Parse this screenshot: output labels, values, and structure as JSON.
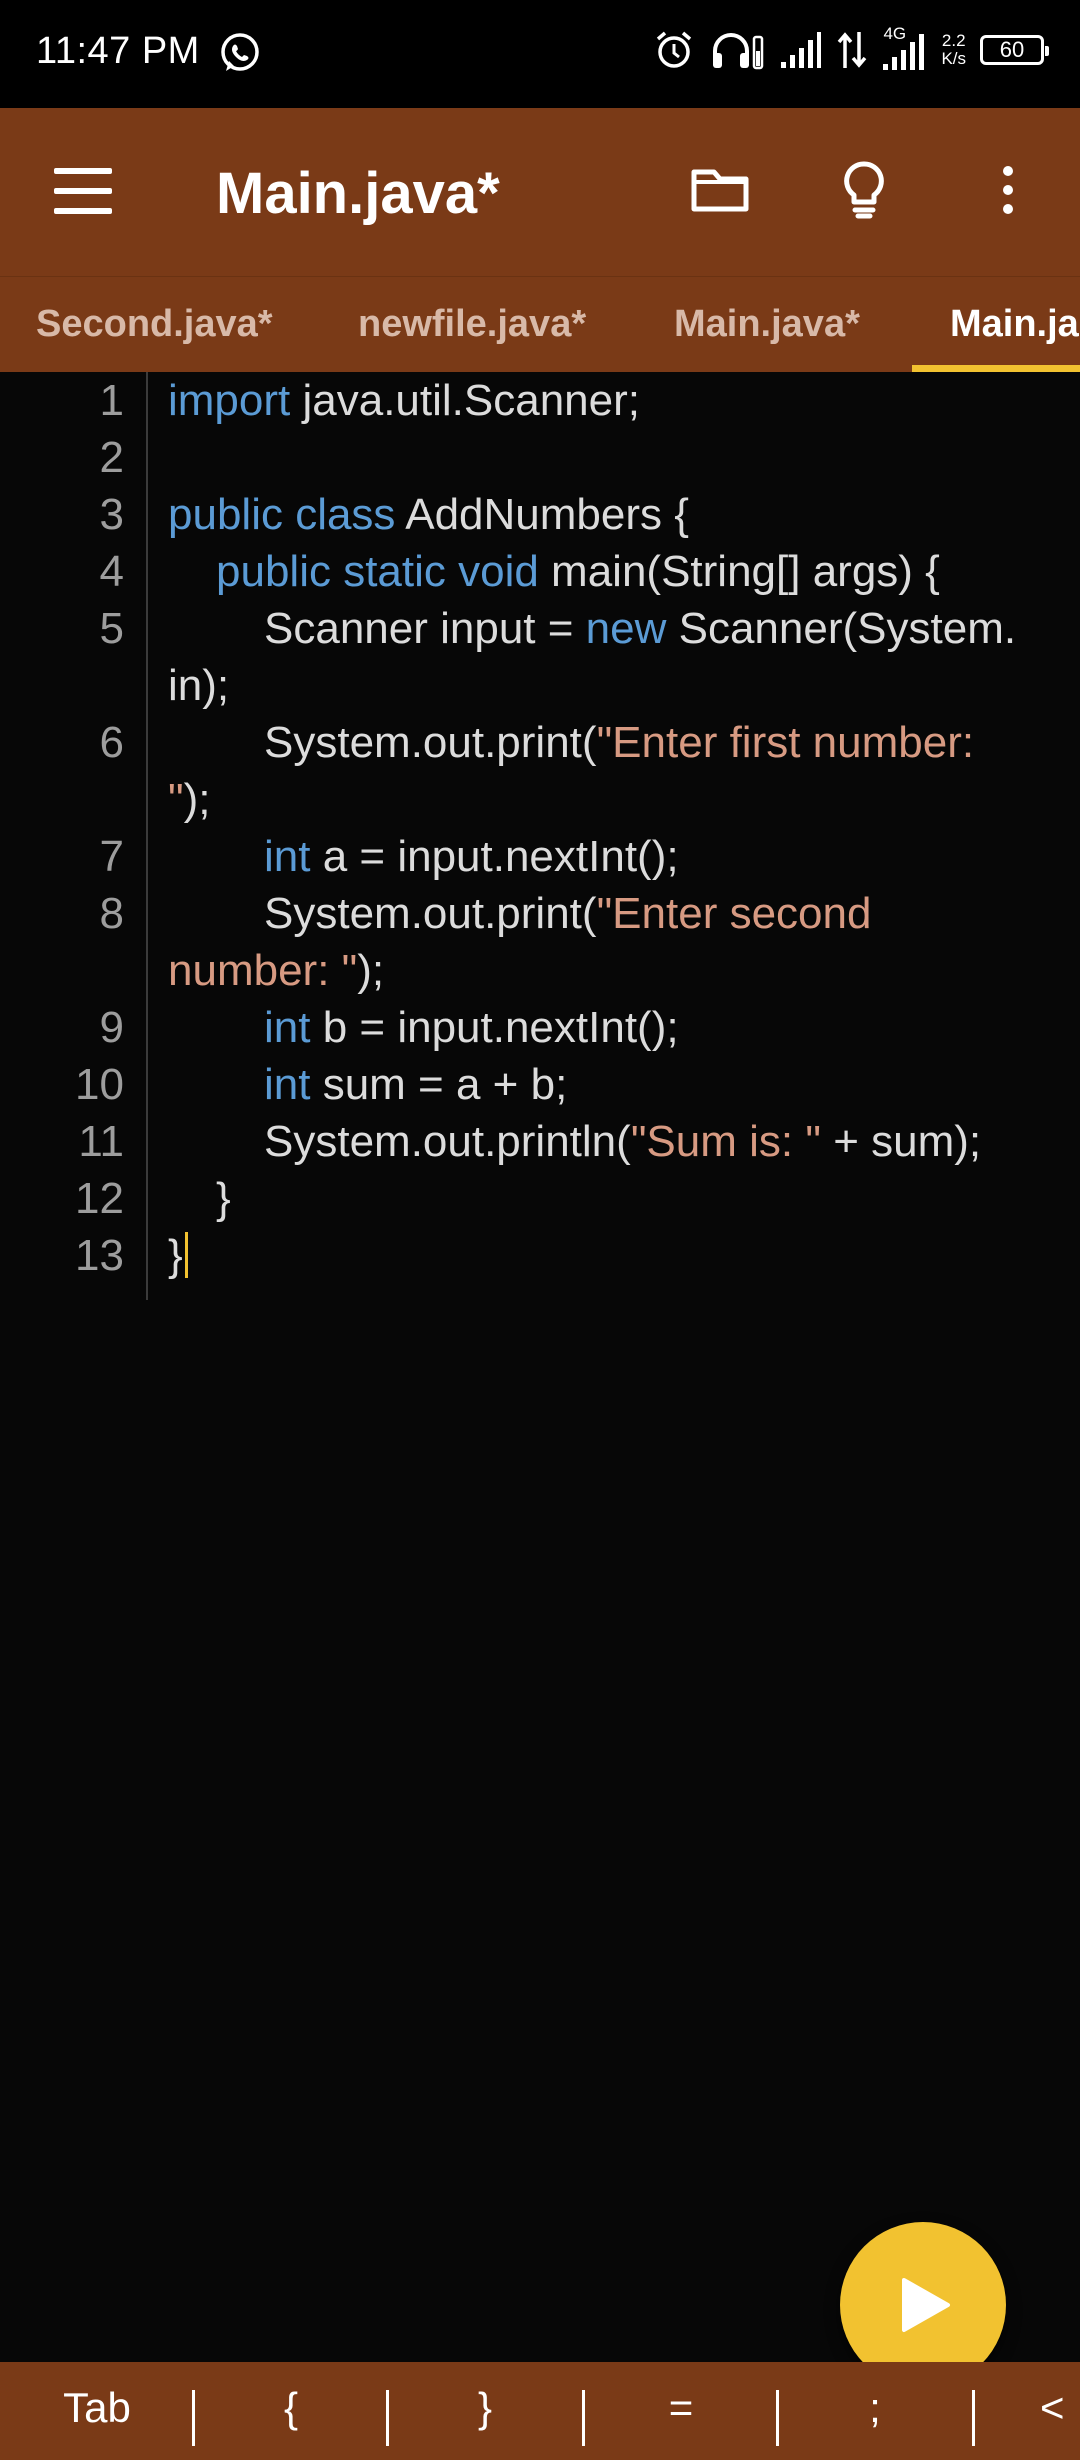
{
  "status_bar": {
    "time": "11:47 PM",
    "network_type": "4G",
    "speed_value": "2.2",
    "speed_unit": "K/s",
    "battery": "60",
    "icons": [
      "whatsapp-icon",
      "alarm-icon",
      "headphones-icon",
      "signal-icon",
      "data-transfer-icon",
      "signal-4g-icon",
      "battery-icon"
    ]
  },
  "app_bar": {
    "title": "Main.java*",
    "icons": [
      "menu-icon",
      "folder-icon",
      "lightbulb-icon",
      "more-vert-icon"
    ]
  },
  "tabs": [
    {
      "label": "Second.java*",
      "active": false
    },
    {
      "label": "newfile.java*",
      "active": false
    },
    {
      "label": "Main.java*",
      "active": false
    },
    {
      "label": "Main.ja",
      "active": true
    }
  ],
  "editor": {
    "line_numbers": [
      "1",
      "2",
      "3",
      "4",
      "5",
      "6",
      "7",
      "8",
      "9",
      "10",
      "11",
      "12",
      "13"
    ],
    "lines": [
      {
        "kw": "import",
        "rest": " java.util.Scanner;"
      },
      {
        "kw1": "public class",
        "rest": " AddNumbers {"
      },
      {
        "kw1": "public static void",
        "rest": " main(String[] args) {"
      },
      {
        "pre": "Scanner input = ",
        "kw1": "new",
        "rest": " Scanner(System.",
        "wrap": "in);"
      },
      {
        "pre": "System.out.print(",
        "str": "\"Enter first number:",
        "wrap_str": "\"",
        "wrap_rest": ");"
      },
      {
        "kw1": "int",
        "rest": " a = input.nextInt();"
      },
      {
        "pre": "System.out.print(",
        "str": "\"Enter second",
        "wrap_str": "number: \"",
        "wrap_rest": ");"
      },
      {
        "kw1": "int",
        "rest": " b = input.nextInt();"
      },
      {
        "kw1": "int",
        "rest": " sum = a + b;"
      },
      {
        "pre": "System.out.println(",
        "str": "\"Sum is: \"",
        "rest": " + sum);"
      },
      {
        "rest": "}"
      },
      {
        "rest": "}"
      }
    ]
  },
  "fab": {
    "icon": "play-icon"
  },
  "key_bar": {
    "keys": [
      "Tab",
      "{",
      "}",
      "=",
      ";",
      "<"
    ]
  },
  "colors": {
    "app_bar": "#7a3a17",
    "accent": "#f2c230",
    "keyword": "#5b9bd5",
    "string": "#d79a82",
    "editor_bg": "#070707"
  }
}
